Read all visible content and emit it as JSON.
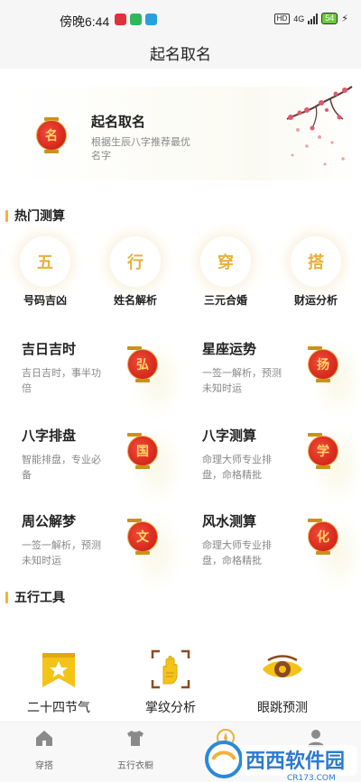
{
  "status_bar": {
    "time": "傍晚6:44",
    "hd": "HD",
    "network": "4G",
    "battery": "54"
  },
  "header": {
    "title": "起名取名"
  },
  "banner": {
    "lantern_char": "名",
    "title": "起名取名",
    "description": "根据生辰八字推荐最优名字"
  },
  "hot_section": {
    "title": "热门测算",
    "items": [
      {
        "char": "五",
        "label": "号码吉凶"
      },
      {
        "char": "行",
        "label": "姓名解析"
      },
      {
        "char": "穿",
        "label": "三元合婚"
      },
      {
        "char": "搭",
        "label": "财运分析"
      }
    ]
  },
  "cards": [
    {
      "title": "吉日吉时",
      "desc": "吉日吉时，事半功倍",
      "lantern": "弘"
    },
    {
      "title": "星座运势",
      "desc": "一签一解析，预测未知时运",
      "lantern": "扬"
    },
    {
      "title": "八字排盘",
      "desc": "智能排盘，专业必备",
      "lantern": "国"
    },
    {
      "title": "八字测算",
      "desc": "命理大师专业排盘，命格精批",
      "lantern": "学"
    },
    {
      "title": "周公解梦",
      "desc": "一签一解析，预测未知时运",
      "lantern": "文"
    },
    {
      "title": "风水测算",
      "desc": "命理大师专业排盘，命格精批",
      "lantern": "化"
    }
  ],
  "tools_section": {
    "title": "五行工具",
    "items": [
      {
        "label": "二十四节气",
        "icon": "solar-term-bookmark-icon"
      },
      {
        "label": "掌纹分析",
        "icon": "palm-scan-icon"
      },
      {
        "label": "眼跳预测",
        "icon": "eye-icon"
      }
    ]
  },
  "nav": {
    "items": [
      {
        "label": "穿搭",
        "icon": "home-icon"
      },
      {
        "label": "五行衣橱",
        "icon": "tshirt-icon"
      },
      {
        "label": "",
        "icon": "compass-icon"
      },
      {
        "label": "",
        "icon": "profile-icon"
      }
    ]
  },
  "watermark": {
    "text": "西西软件园",
    "sub": "CR173.COM"
  },
  "colors": {
    "accent": "#f0b33a",
    "lantern_red": "#d8241a",
    "gold_text": "#e9b03a"
  }
}
